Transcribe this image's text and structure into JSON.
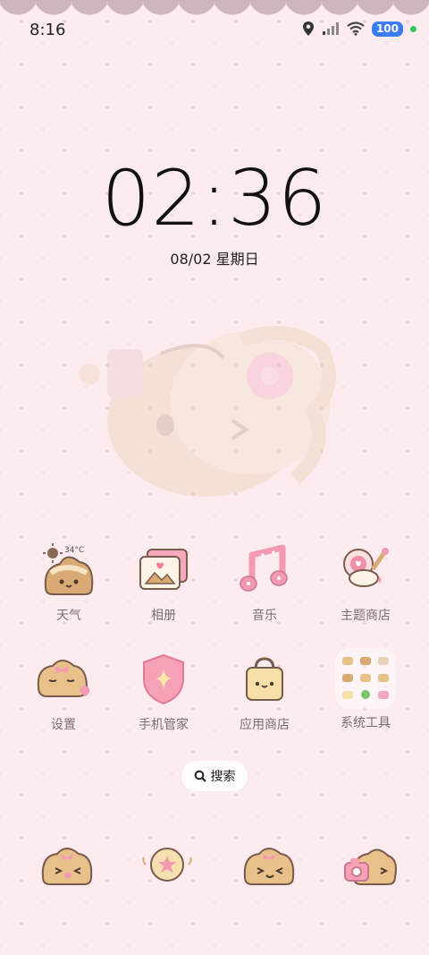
{
  "status_bar": {
    "time": "8:16",
    "battery": "100",
    "icons": [
      "location-icon",
      "signal-icon",
      "wifi-icon",
      "battery-icon",
      "privacy-dot-icon"
    ]
  },
  "clock": {
    "time": "02:36",
    "date": "08/02 星期日"
  },
  "apps": [
    {
      "label": "天气",
      "icon": "weather-icon",
      "temp": "34°C"
    },
    {
      "label": "相册",
      "icon": "gallery-icon"
    },
    {
      "label": "音乐",
      "icon": "music-icon"
    },
    {
      "label": "主题商店",
      "icon": "theme-store-icon"
    },
    {
      "label": "设置",
      "icon": "settings-icon"
    },
    {
      "label": "手机管家",
      "icon": "phone-manager-icon"
    },
    {
      "label": "应用商店",
      "icon": "app-store-icon"
    },
    {
      "label": "系统工具",
      "icon": "system-tools-folder-icon"
    }
  ],
  "search": {
    "label": "搜索",
    "icon": "search-icon"
  },
  "dock": [
    "phone-icon",
    "messages-icon",
    "browser-icon",
    "camera-icon"
  ],
  "colors": {
    "background": "#fcecef",
    "accent_pink": "#f59ab0",
    "bun_tan": "#e7c08a",
    "outline": "#7a5b4c",
    "battery_blue": "#3b7cf3"
  }
}
